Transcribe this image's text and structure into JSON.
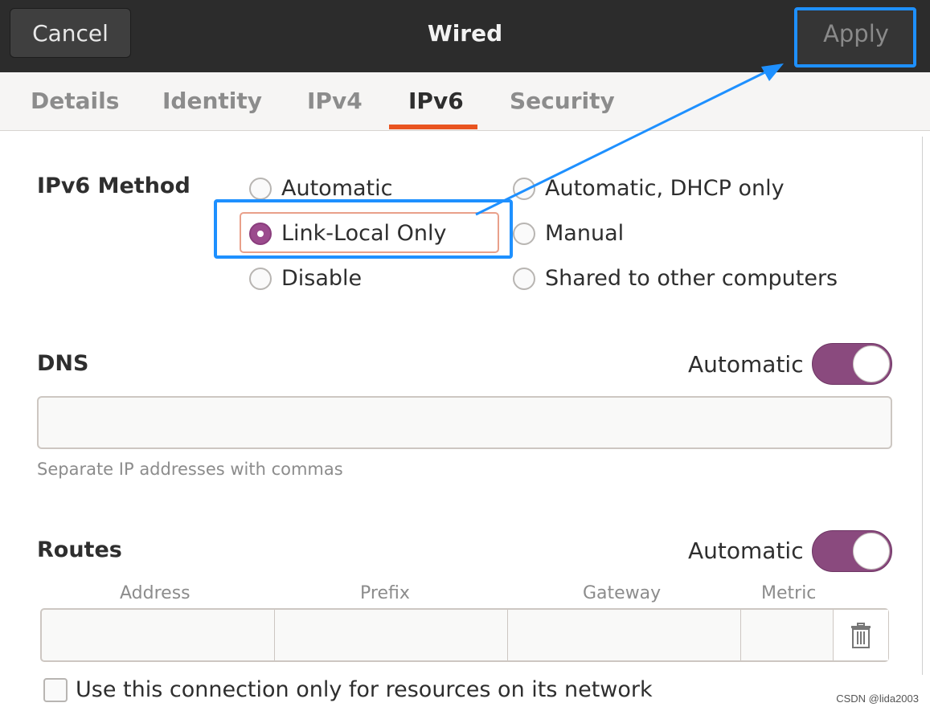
{
  "header": {
    "title": "Wired",
    "cancel_label": "Cancel",
    "apply_label": "Apply"
  },
  "tabs": [
    {
      "label": "Details",
      "active": false
    },
    {
      "label": "Identity",
      "active": false
    },
    {
      "label": "IPv4",
      "active": false
    },
    {
      "label": "IPv6",
      "active": true
    },
    {
      "label": "Security",
      "active": false
    }
  ],
  "ipv6_method": {
    "label": "IPv6 Method",
    "options": [
      {
        "label": "Automatic",
        "checked": false
      },
      {
        "label": "Automatic, DHCP only",
        "checked": false
      },
      {
        "label": "Link-Local Only",
        "checked": true
      },
      {
        "label": "Manual",
        "checked": false
      },
      {
        "label": "Disable",
        "checked": false
      },
      {
        "label": "Shared to other computers",
        "checked": false
      }
    ]
  },
  "dns": {
    "label": "DNS",
    "automatic_label": "Automatic",
    "automatic_on": true,
    "entry_value": "",
    "hint": "Separate IP addresses with commas"
  },
  "routes": {
    "label": "Routes",
    "automatic_label": "Automatic",
    "automatic_on": true,
    "columns": [
      "Address",
      "Prefix",
      "Gateway",
      "Metric"
    ],
    "row": [
      "",
      "",
      "",
      ""
    ]
  },
  "only_resources_checkbox": {
    "label": "Use this connection only for resources on its network",
    "checked": false
  },
  "watermark": "CSDN @lida2003",
  "colors": {
    "accent_orange": "#e95420",
    "radio_checked": "#9b4b8d",
    "switch_on": "#8a4a7e",
    "annotation_blue": "#1e90ff"
  },
  "icons": {
    "trash": "trash-icon"
  }
}
